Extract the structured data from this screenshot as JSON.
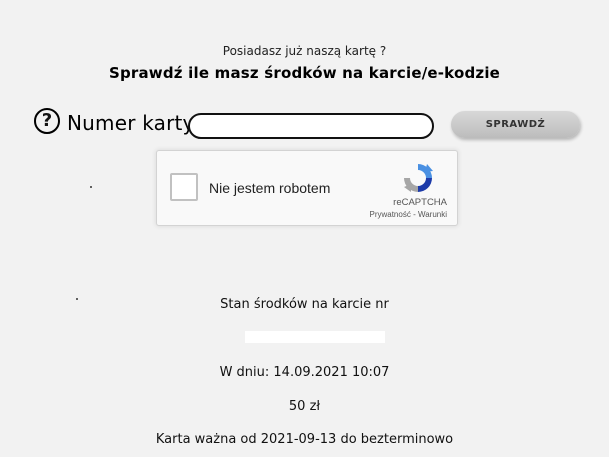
{
  "form": {
    "intro": "Posiadasz już naszą kartę ?",
    "heading": "Sprawdź ile masz środków na karcie/e-kodzie",
    "help_icon_glyph": "?",
    "card_label": "Numer karty",
    "card_value": "",
    "check_label": "SPRAWDŹ"
  },
  "captcha": {
    "label": "Nie jestem robotem",
    "brand": "reCAPTCHA",
    "privacy": "Prywatność",
    "separator": " - ",
    "terms": "Warunki"
  },
  "result": {
    "balance_label": "Stan środków na karcie nr",
    "date_line": "W dniu: 14.09.2021 10:07",
    "amount": "50 zł",
    "validity": "Karta ważna od 2021-09-13 do bezterminowo"
  }
}
